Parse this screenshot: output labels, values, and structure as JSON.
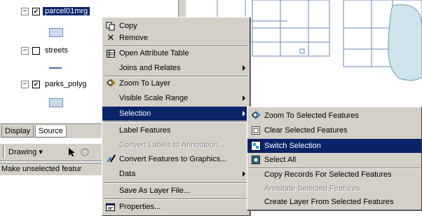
{
  "toc": {
    "layers": [
      {
        "name": "parcel01mrg",
        "expander": "−",
        "checked": "✔"
      },
      {
        "name": "streets",
        "expander": "−",
        "checked": ""
      },
      {
        "name": "parks_polyg",
        "expander": "−",
        "checked": "✔"
      }
    ],
    "tabs": {
      "display": "Display",
      "source": "Source"
    },
    "drawing_label": "Drawing ▾",
    "status_text": "Make unselected featur"
  },
  "context_menu": {
    "items": [
      {
        "label": "Copy",
        "icon": "copy-icon"
      },
      {
        "label": "Remove",
        "icon": "remove-x-icon"
      },
      {
        "label": "Open Attribute Table",
        "icon": "table-icon"
      },
      {
        "label": "Joins and Relates",
        "icon": ""
      },
      {
        "label": "Zoom To Layer",
        "icon": "zoom-layer-icon"
      },
      {
        "label": "Visible Scale Range",
        "icon": ""
      },
      {
        "label": "Selection",
        "icon": ""
      },
      {
        "label": "Label Features",
        "icon": ""
      },
      {
        "label": "Convert Labels to Annotation...",
        "icon": ""
      },
      {
        "label": "Convert Features to Graphics...",
        "icon": "convert-graphics-icon"
      },
      {
        "label": "Data",
        "icon": ""
      },
      {
        "label": "Save As Layer File...",
        "icon": ""
      },
      {
        "label": "Properties...",
        "icon": "properties-icon"
      }
    ]
  },
  "selection_submenu": {
    "items": [
      {
        "label": "Zoom To Selected Features",
        "icon": "zoom-selected-icon"
      },
      {
        "label": "Clear Selected Features",
        "icon": "clear-selection-icon"
      },
      {
        "label": "Switch Selection",
        "icon": "switch-selection-icon"
      },
      {
        "label": "Select All",
        "icon": "select-all-icon"
      },
      {
        "label": "Copy Records For Selected Features",
        "icon": ""
      },
      {
        "label": "Annotate Selected Features",
        "icon": ""
      },
      {
        "label": "Create Layer From Selected Features",
        "icon": ""
      }
    ]
  },
  "colors": {
    "highlight": "#0a246a",
    "menu_bg": "#d4d0c8",
    "map_line": "#6a86b8",
    "parks_fill": "#cfe4ec"
  }
}
